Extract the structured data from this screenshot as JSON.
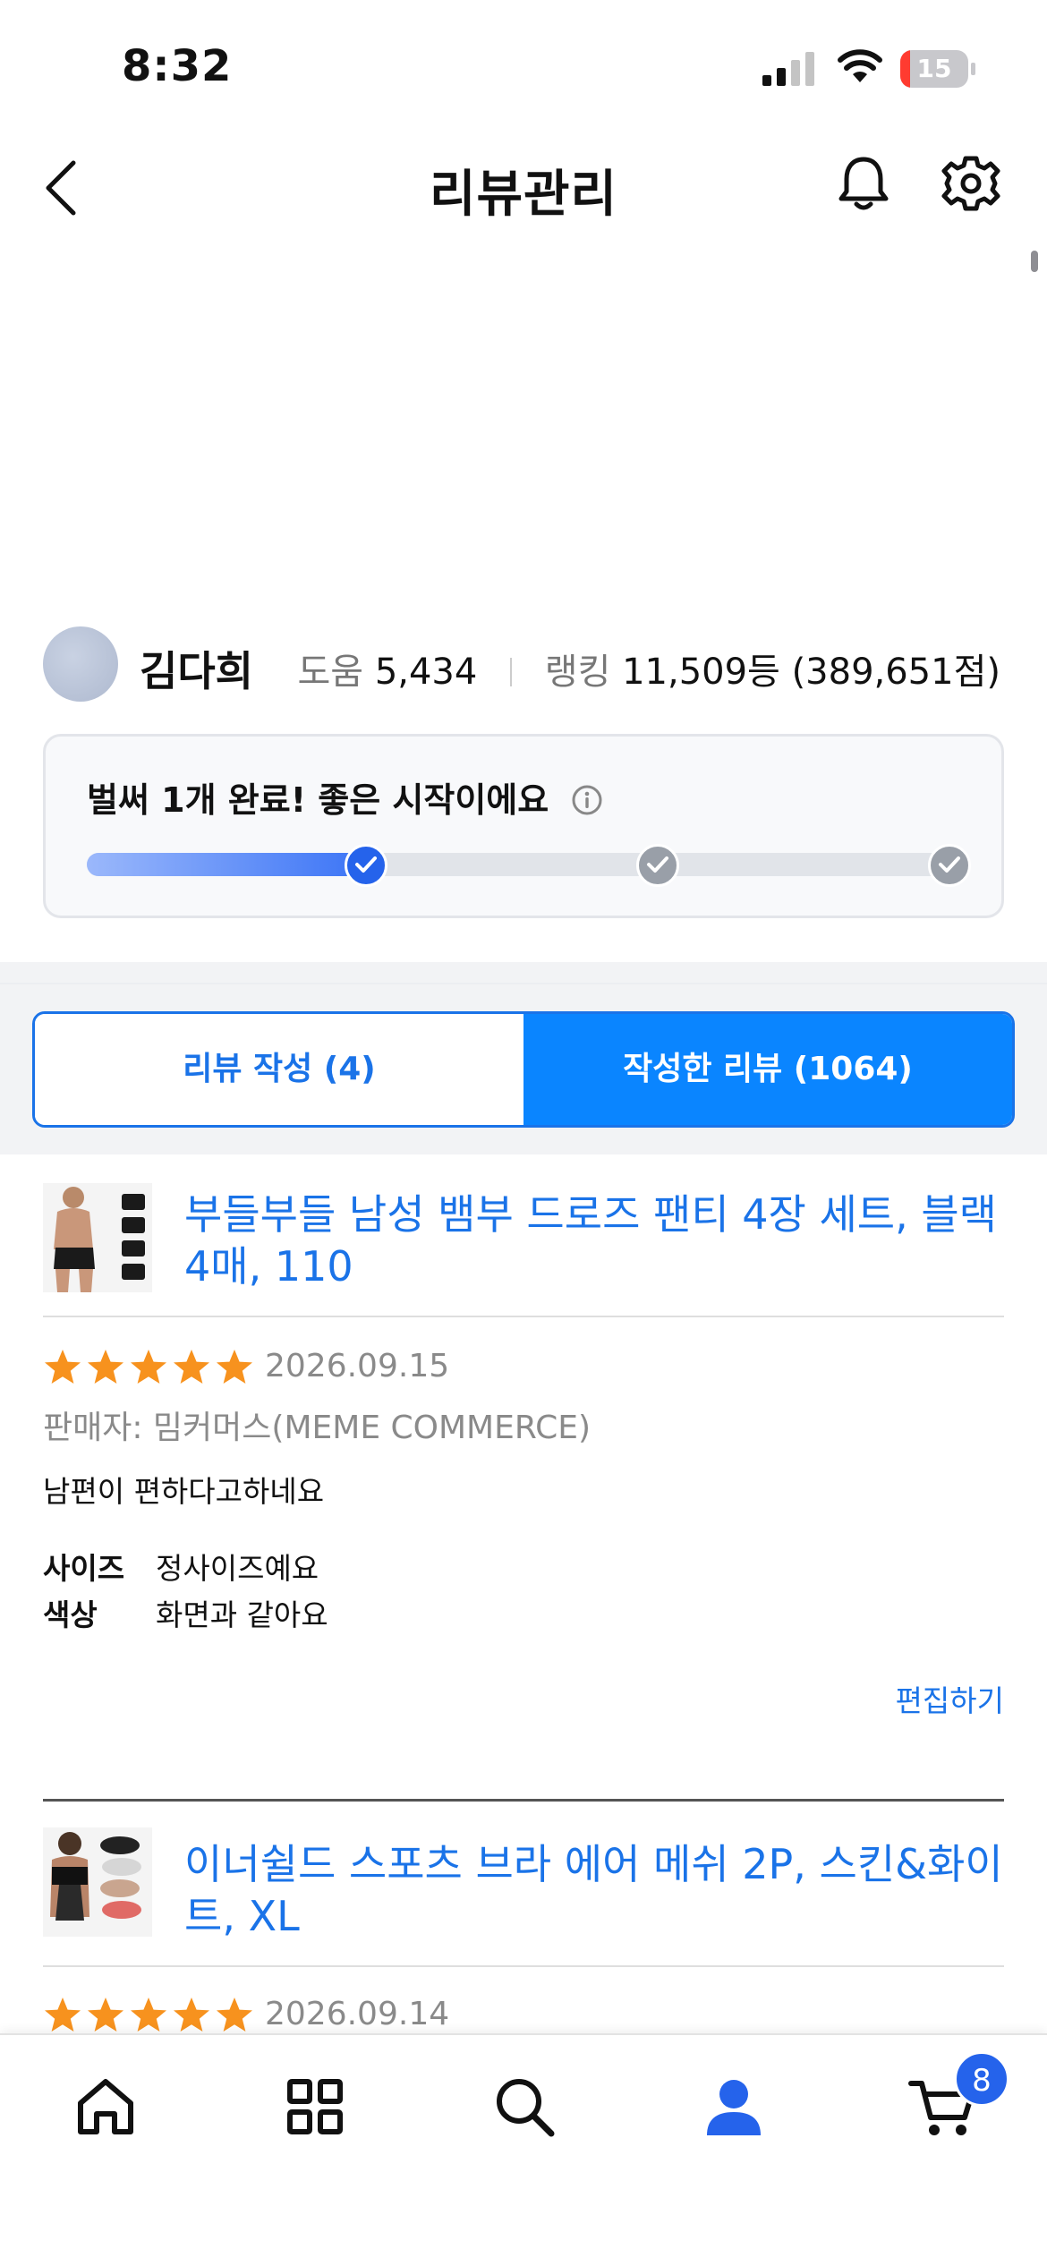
{
  "status_bar": {
    "time": "8:32",
    "battery_percent": 15,
    "battery_label": "15"
  },
  "header": {
    "title": "리뷰관리",
    "icons": [
      "chevron-left-icon",
      "bell-icon",
      "gear-icon"
    ]
  },
  "profile": {
    "name": "김다희",
    "help_label": "도움",
    "help_value": "5,434",
    "ranking_label": "랭킹",
    "ranking_value": "11,509등 (389,651점)"
  },
  "progress": {
    "message": "벌써 1개 완료! 좋은 시작이에요",
    "fill_fraction": 0.32,
    "steps_total": 3,
    "steps_completed": 1
  },
  "tabs": {
    "write": "리뷰 작성 (4)",
    "written": "작성한 리뷰 (1064)",
    "active": "written"
  },
  "reviews": [
    {
      "product": "부들부들 남성 뱀부 드로즈 팬티 4장 세트, 블랙4매, 110",
      "rating": 5,
      "date": "2026.09.15",
      "seller": "판매자: 밈커머스(MEME COMMERCE)",
      "text": "남편이 편하다고하네요",
      "attributes": [
        {
          "key": "사이즈",
          "value": "정사이즈예요"
        },
        {
          "key": "색상",
          "value": "화면과 같아요"
        }
      ],
      "edit_label": "편집하기"
    },
    {
      "product": "이너쉴드 스포츠 브라 에어 메쉬 2P, 스킨&화이트, XL",
      "rating": 5,
      "date": "2026.09.14"
    }
  ],
  "bottom_nav": {
    "items": [
      "home-icon",
      "category-grid-icon",
      "search-icon",
      "profile-icon",
      "cart-icon"
    ],
    "active": "profile-icon",
    "cart_count": "8"
  },
  "colors": {
    "accent": "#1a73e8",
    "active_tab": "#0a85ff",
    "star": "#f7921e",
    "battery_low": "#ff3b30"
  }
}
